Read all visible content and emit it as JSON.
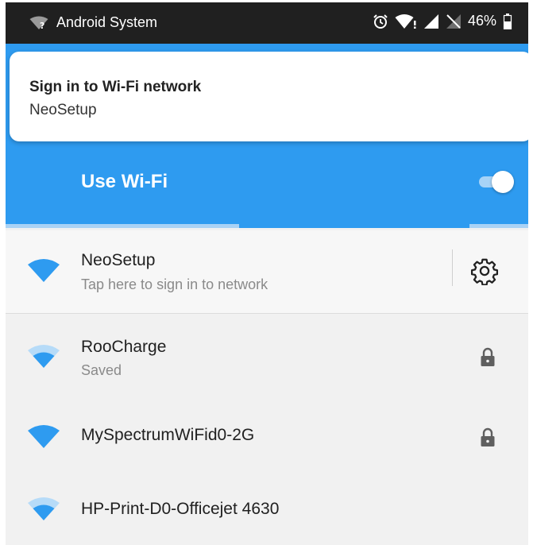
{
  "status_bar": {
    "app_name": "Android System",
    "battery_percent": "46%",
    "icons": [
      "wifi-question-icon",
      "alarm-icon",
      "wifi-signal-icon",
      "cell-signal-icon",
      "no-sim-icon",
      "battery-icon"
    ]
  },
  "notification": {
    "title": "Sign in to Wi-Fi network",
    "body": "NeoSetup"
  },
  "wifi_toggle": {
    "label": "Use Wi-Fi",
    "enabled": true
  },
  "colors": {
    "accent": "#2e9bf0",
    "status_bar": "#202020",
    "wifi_icon": "#2e9bf0"
  },
  "networks": [
    {
      "name": "NeoSetup",
      "status": "Tap here to sign in to network",
      "signal": "full",
      "secured": false,
      "action_icon": "gear-icon"
    },
    {
      "name": "RooCharge",
      "status": "Saved",
      "signal": "medium",
      "secured": true
    },
    {
      "name": "MySpectrumWiFid0-2G",
      "status": "",
      "signal": "full",
      "secured": true
    },
    {
      "name": "HP-Print-D0-Officejet 4630",
      "status": "",
      "signal": "medium",
      "secured": false
    }
  ]
}
